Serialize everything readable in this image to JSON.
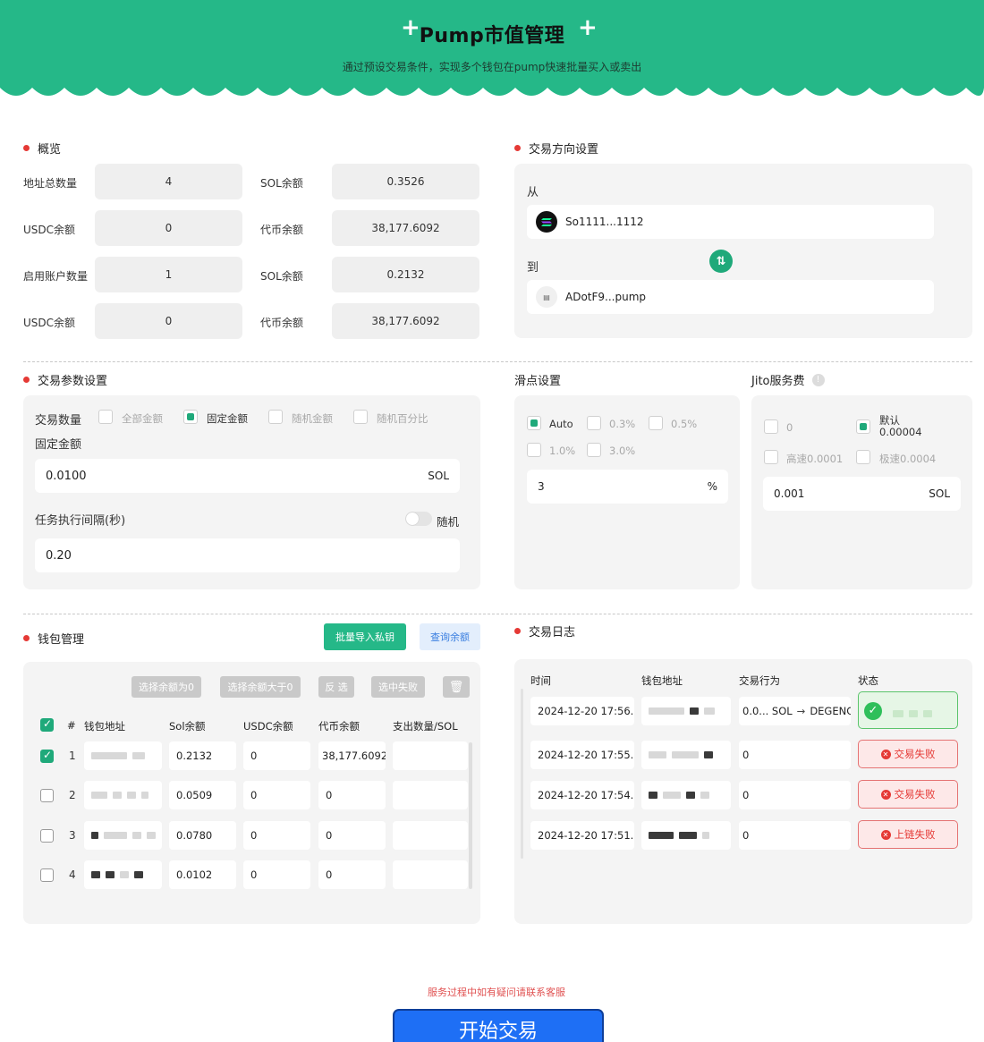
{
  "header": {
    "title": "Pump市值管理",
    "subtitle": "通过预设交易条件，实现多个钱包在pump快速批量买入或卖出",
    "accent": "#25b888"
  },
  "overview": {
    "title": "概览",
    "rows": [
      {
        "label1": "地址总数量",
        "value1": "4",
        "label2": "SOL余额",
        "value2": "0.3526"
      },
      {
        "label1": "USDC余额",
        "value1": "0",
        "label2": "代币余额",
        "value2": "38,177.6092"
      },
      {
        "label1": "启用账户数量",
        "value1": "1",
        "label2": "SOL余额",
        "value2": "0.2132"
      },
      {
        "label1": "USDC余额",
        "value1": "0",
        "label2": "代币余额",
        "value2": "38,177.6092"
      }
    ]
  },
  "direction": {
    "title": "交易方向设置",
    "from_label": "从",
    "from_token": "So1111...1112",
    "to_label": "到",
    "to_token": "ADotF9...pump",
    "swap_icon": "swap-arrows-icon"
  },
  "trade_params": {
    "title": "交易参数设置",
    "qty_label": "交易数量",
    "options": [
      "全部金额",
      "固定金额",
      "随机金额",
      "随机百分比"
    ],
    "selected_option": "固定金额",
    "fixed_label": "固定金额",
    "fixed_value": "0.0100",
    "fixed_unit": "SOL",
    "interval_label": "任务执行间隔(秒)",
    "random_label": "随机",
    "interval_value": "0.20"
  },
  "slippage": {
    "title": "滑点设置",
    "options": [
      "Auto",
      "0.3%",
      "0.5%",
      "1.0%",
      "3.0%"
    ],
    "selected": "Auto",
    "value": "3",
    "unit": "%"
  },
  "jito": {
    "title": "Jito服务费",
    "opt_zero": "0",
    "opt_default_label": "默认",
    "opt_default_value": "0.00004",
    "opt_fast": "高速0.0001",
    "opt_ultra": "极速0.0004",
    "value": "0.001",
    "unit": "SOL"
  },
  "wallets": {
    "title": "钱包管理",
    "import_btn": "批量导入私钥",
    "query_btn": "查询余额",
    "filters": [
      "选择余额为0",
      "选择余额大于0",
      "反 选",
      "选中失败"
    ],
    "headers": [
      "#",
      "钱包地址",
      "Sol余额",
      "USDC余额",
      "代币余额",
      "支出数量/SOL"
    ],
    "rows": [
      {
        "no": "1",
        "sol": "0.2132",
        "usdc": "0",
        "token": "38,177.6092",
        "checked": true
      },
      {
        "no": "2",
        "sol": "0.0509",
        "usdc": "0",
        "token": "0",
        "checked": false
      },
      {
        "no": "3",
        "sol": "0.0780",
        "usdc": "0",
        "token": "0",
        "checked": false
      },
      {
        "no": "4",
        "sol": "0.0102",
        "usdc": "0",
        "token": "0",
        "checked": false
      }
    ]
  },
  "log": {
    "title": "交易日志",
    "headers": [
      "时间",
      "钱包地址",
      "交易行为",
      "状态"
    ],
    "rows": [
      {
        "time": "2024-12-20 17:56...",
        "action_from": "0.0... SOL",
        "action_to": "DEGENG",
        "status": "success"
      },
      {
        "time": "2024-12-20 17:55...",
        "action": "0",
        "status": "交易失败"
      },
      {
        "time": "2024-12-20 17:54...",
        "action": "0",
        "status": "交易失败"
      },
      {
        "time": "2024-12-20 17:51...",
        "action": "0",
        "status": "上链失败"
      }
    ]
  },
  "footer": {
    "note": "服务过程中如有疑问请联系客服",
    "start_btn": "开始交易"
  }
}
